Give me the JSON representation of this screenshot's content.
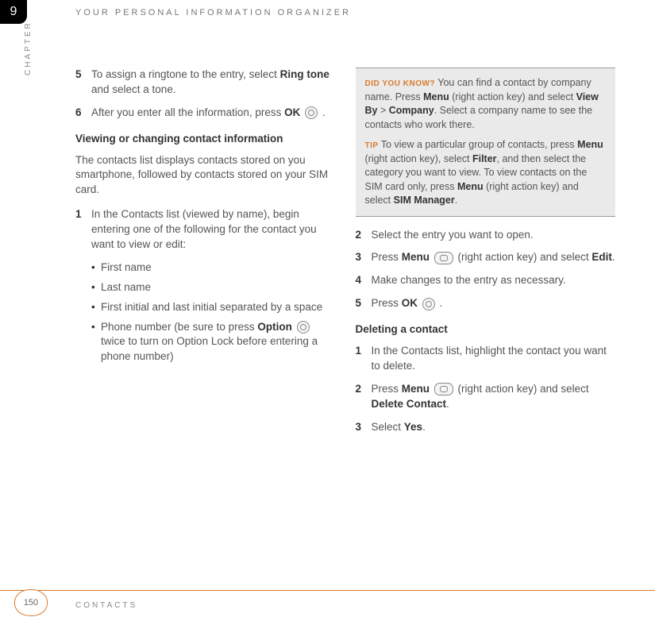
{
  "chapter_number": "9",
  "header": "YOUR PERSONAL INFORMATION ORGANIZER",
  "chapter_label": "CHAPTER",
  "left": {
    "step5": {
      "num": "5",
      "t1": "To assign a ringtone to the entry, select ",
      "b1": "Ring tone",
      "t2": " and select a tone."
    },
    "step6": {
      "num": "6",
      "t1": "After you enter all the information, press ",
      "b1": "OK",
      "t2": " ."
    },
    "section1_head": "Viewing or changing contact information",
    "section1_para": "The contacts list displays contacts stored on you smartphone, followed by contacts stored on your SIM card.",
    "step1": {
      "num": "1",
      "text": "In the Contacts list (viewed by name), begin entering one of the following for the contact you want to view or edit:"
    },
    "bullets": [
      {
        "text": "First name"
      },
      {
        "text": "Last name"
      },
      {
        "text": "First initial and last initial separated by a space"
      },
      {
        "t1": "Phone number (be sure to press ",
        "b1": "Option",
        "t2": " twice to turn on Option Lock before entering a phone number)"
      }
    ]
  },
  "tipbox": {
    "dyk_label": "DID YOU KNOW?",
    "dyk_t1": " You can find a contact by company name. Press ",
    "dyk_b1": "Menu",
    "dyk_t2": " (right action key) and select ",
    "dyk_b2": "View By",
    "dyk_gt": " > ",
    "dyk_b3": "Company",
    "dyk_t3": ". Select a company name to see the contacts who work there.",
    "tip_label": "TIP",
    "tip_t1": " To view a particular group of contacts, press ",
    "tip_b1": "Menu",
    "tip_t2": " (right action key), select ",
    "tip_b2": "Filter",
    "tip_t3": ", and then select the category you want to view. To view contacts on the SIM card only, press ",
    "tip_b3": "Menu",
    "tip_t4": " (right action key) and select ",
    "tip_b4": "SIM Manager",
    "tip_t5": "."
  },
  "right": {
    "step2": {
      "num": "2",
      "text": "Select the entry you want to open."
    },
    "step3": {
      "num": "3",
      "t1": "Press ",
      "b1": "Menu",
      "t2": " (right action key) and select ",
      "b2": "Edit",
      "t3": "."
    },
    "step4": {
      "num": "4",
      "text": "Make changes to the entry as necessary."
    },
    "step5": {
      "num": "5",
      "t1": "Press ",
      "b1": "OK",
      "t2": " ."
    },
    "section2_head": "Deleting a contact",
    "d1": {
      "num": "1",
      "text": "In the Contacts list, highlight the contact you want to delete."
    },
    "d2": {
      "num": "2",
      "t1": "Press ",
      "b1": "Menu",
      "t2": " (right action key) and select ",
      "b2": "Delete Contact",
      "t3": "."
    },
    "d3": {
      "num": "3",
      "t1": "Select ",
      "b1": "Yes",
      "t2": "."
    }
  },
  "footer": {
    "page": "150",
    "section": "CONTACTS"
  }
}
